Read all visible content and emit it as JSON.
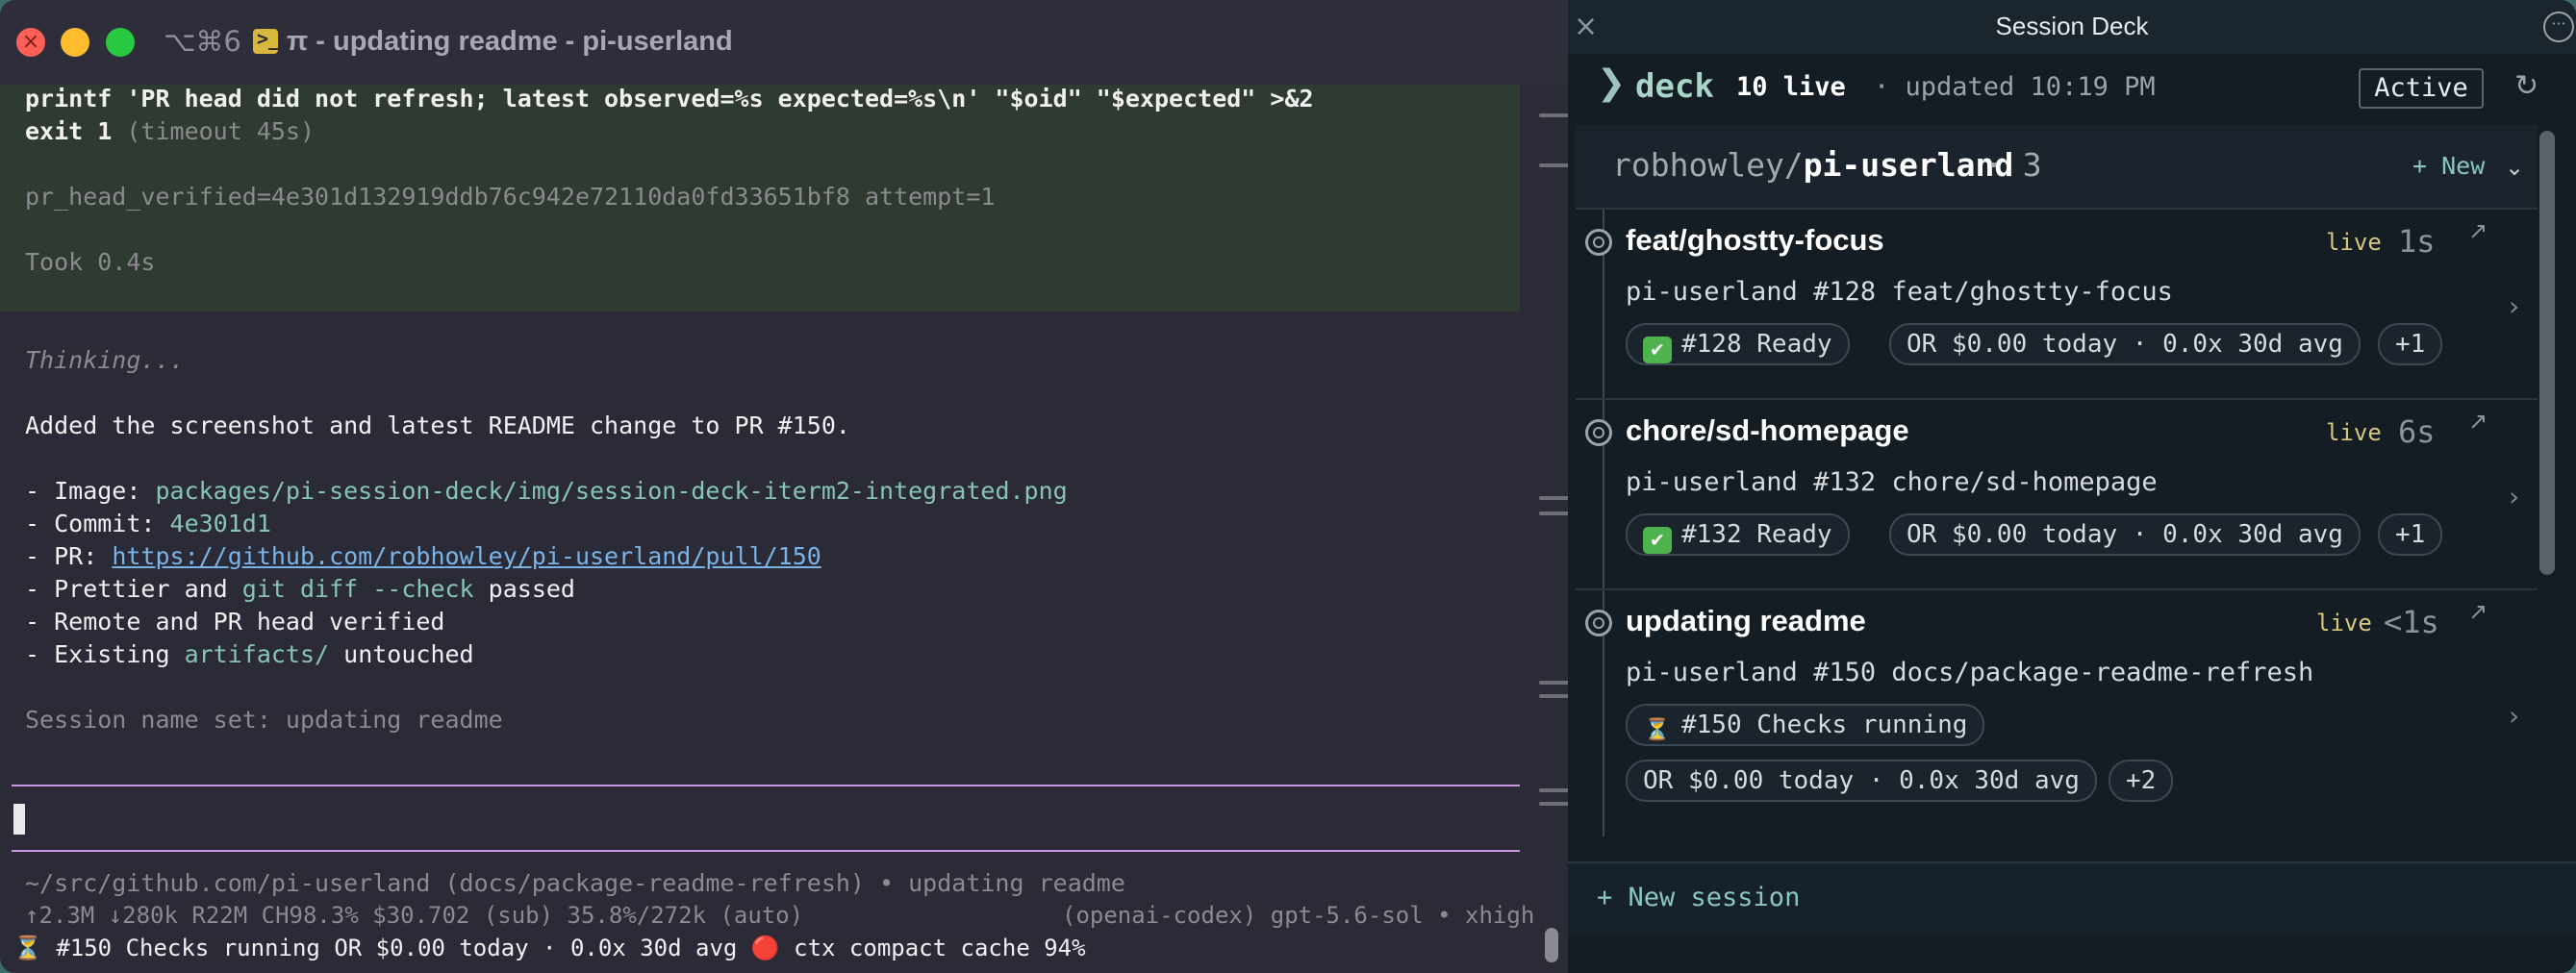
{
  "terminal": {
    "traffic_lights": [
      "close",
      "minimize",
      "zoom"
    ],
    "close_glyph": "×",
    "tab_shortcut": "⌥⌘6",
    "tab_icon_glyph": ">_",
    "window_title": "π - updating readme - pi-userland",
    "cmd_lines": [
      "printf 'PR head did not refresh; latest observed=%s expected=%s\\n' \"$oid\" \"$expected\" >&2",
      "exit 1"
    ],
    "cmd_timeout": "(timeout 45s)",
    "output_verified": "pr_head_verified=4e301d132919ddb76c942e72110da0fd33651bf8 attempt=1",
    "took": "Took 0.4s",
    "thinking": "Thinking...",
    "summary": "Added the screenshot and latest README change to PR #150.",
    "bullets": {
      "image_label": "- Image: ",
      "image_value": "packages/pi-session-deck/img/session-deck-iterm2-integrated.png",
      "commit_label": "- Commit: ",
      "commit_value": "4e301d1",
      "pr_label": "- PR: ",
      "pr_value": "https://github.com/robhowley/pi-userland/pull/150",
      "prettier_a": "- Prettier and ",
      "prettier_code": "git diff --check",
      "prettier_b": " passed",
      "remote": "- Remote and PR head verified",
      "existing_a": "- Existing ",
      "existing_code": "artifacts/",
      "existing_b": " untouched"
    },
    "session_name_msg": "Session name set: updating readme",
    "status_path": "~/src/github.com/pi-userland (docs/package-readme-refresh) • updating readme",
    "status_tokens": "↑2.3M ↓280k R22M CH98.3% $30.702 (sub) 35.8%/272k (auto)",
    "status_model": "(openai-codex) gpt-5.6-sol • xhigh",
    "status_bottom": "⏳ #150 Checks running OR $0.00 today · 0.0x 30d avg 🔴 ctx compact cache 94%"
  },
  "deck": {
    "window_title": "Session Deck",
    "close_glyph": "×",
    "menu_glyph": "···",
    "header": {
      "chevron": "❯",
      "name": "deck",
      "live": "10 live",
      "updated": "· updated 10:19 PM",
      "filter": "Active",
      "refresh": "↻"
    },
    "repo": {
      "owner": "robhowley/",
      "name": "pi-userland",
      "count": "· 3",
      "new_label": "+ New",
      "collapse": "⌄"
    },
    "sessions": [
      {
        "title": "feat/ghostty-focus",
        "live": "live",
        "age": "1s",
        "open": "↗",
        "subtitle": "pi-userland #128 feat/ghostty-focus",
        "chips": [
          "#128 Ready",
          "OR $0.00 today · 0.0x 30d avg",
          "+1"
        ],
        "arrow": "›"
      },
      {
        "title": "chore/sd-homepage",
        "live": "live",
        "age": "6s",
        "open": "↗",
        "subtitle": "pi-userland #132 chore/sd-homepage",
        "chips": [
          "#132 Ready",
          "OR $0.00 today · 0.0x 30d avg",
          "+1"
        ],
        "arrow": "›"
      },
      {
        "title": "updating readme",
        "live": "live",
        "age": "<1s",
        "open": "↗",
        "subtitle": "pi-userland #150 docs/package-readme-refresh",
        "chips": [
          "#150 Checks running",
          "OR $0.00 today · 0.0x 30d avg",
          "+2"
        ],
        "arrow": "›"
      }
    ],
    "chip_icons": {
      "check": "✔",
      "hourglass": "⏳"
    },
    "new_session": "+ New session"
  }
}
